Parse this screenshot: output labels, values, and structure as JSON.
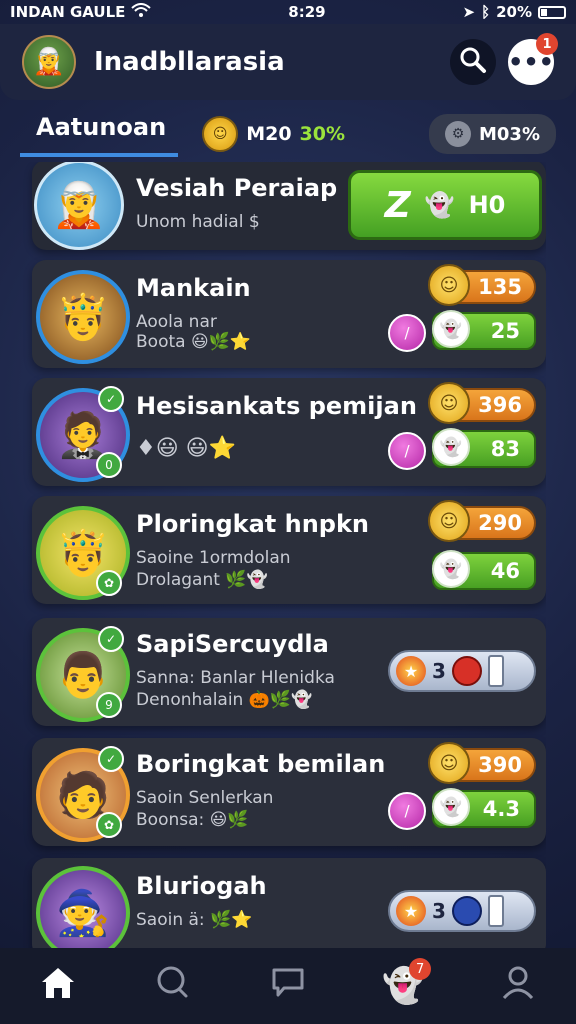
{
  "status": {
    "carrier": "INDAN GAULE",
    "time": "8:29",
    "battery": "20%"
  },
  "header": {
    "title": "Inadbllarasia",
    "notif_count": "1"
  },
  "tabs": {
    "active": "Aatunoan",
    "coin_label": "M20",
    "coin_percent": "30%",
    "right_label": "M03%"
  },
  "featured": {
    "title": "Vesiah Peraiap",
    "subtitle": "Unom hadial $",
    "button_value": "H0",
    "button_glyph": "Z"
  },
  "cards": [
    {
      "title": "Mankain",
      "sub1": "Aoola nar",
      "sub2": "Boota",
      "orange": "135",
      "green": "25"
    },
    {
      "title": "Hesisankats pemijan",
      "sub1": "",
      "sub2": "",
      "orange": "396",
      "green": "83"
    },
    {
      "title": "Ploringkat hnpkn",
      "sub1": "Saoine 1ormdolan",
      "sub2": "Drolagant",
      "orange": "290",
      "green": "46"
    },
    {
      "title": "SapiSercuydla",
      "sub1": "Sanna: Banlar Hlenidka",
      "sub2": "Denonhalain",
      "white_num": "3"
    },
    {
      "title": "Boringkat bemilan",
      "sub1": "Saoin Senlerkan",
      "sub2": "Boonsa:",
      "orange": "390",
      "green": "4.3"
    },
    {
      "title": "Bluriogah",
      "sub1": "Saoin ä:",
      "sub2": "",
      "white_num": "3"
    }
  ],
  "nav": {
    "badge": "7"
  },
  "colors": {
    "accent_green": "#48a023",
    "accent_orange": "#d9751b",
    "tab_underline": "#3f8ce0"
  }
}
